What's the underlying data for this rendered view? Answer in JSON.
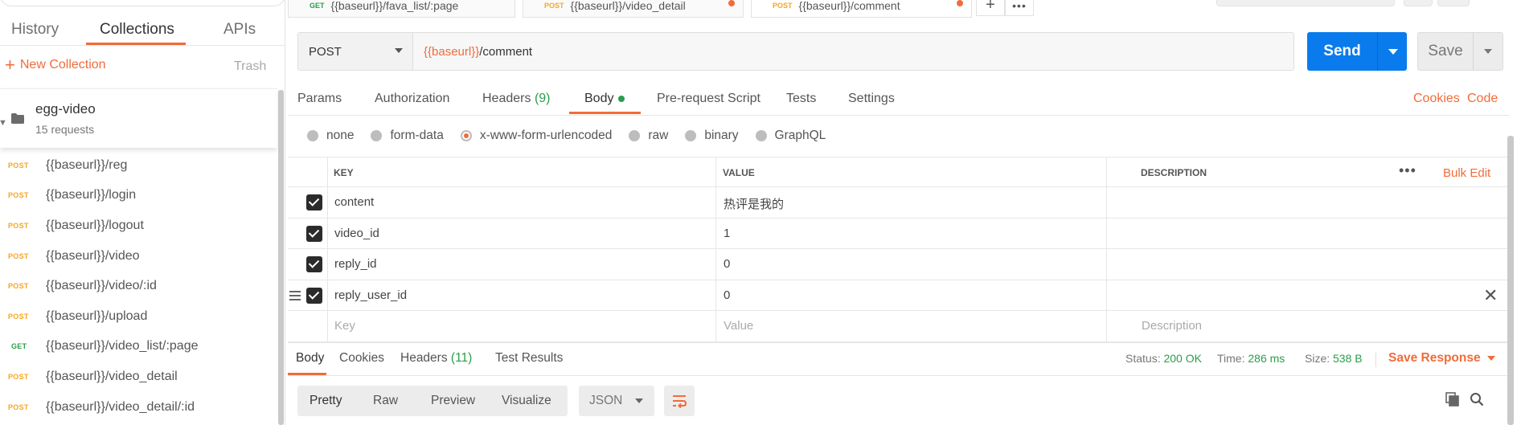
{
  "sidebar": {
    "tabs": [
      "History",
      "Collections",
      "APIs"
    ],
    "active_tab": "Collections",
    "new_collection": "New Collection",
    "trash": "Trash",
    "collection": {
      "name": "egg-video",
      "count": "15 requests"
    },
    "requests": [
      {
        "method": "POST",
        "path": "{{baseurl}}/reg"
      },
      {
        "method": "POST",
        "path": "{{baseurl}}/login"
      },
      {
        "method": "POST",
        "path": "{{baseurl}}/logout"
      },
      {
        "method": "POST",
        "path": "{{baseurl}}/video"
      },
      {
        "method": "POST",
        "path": "{{baseurl}}/video/:id"
      },
      {
        "method": "POST",
        "path": "{{baseurl}}/upload"
      },
      {
        "method": "GET",
        "path": "{{baseurl}}/video_list/:page"
      },
      {
        "method": "POST",
        "path": "{{baseurl}}/video_detail"
      },
      {
        "method": "POST",
        "path": "{{baseurl}}/video_detail/:id"
      }
    ]
  },
  "open_tabs": [
    {
      "method": "GET",
      "path": "{{baseurl}}/fava_list/:page"
    },
    {
      "method": "POST",
      "path": "{{baseurl}}/video_detail"
    },
    {
      "method": "POST",
      "path": "{{baseurl}}/comment"
    }
  ],
  "request": {
    "method": "POST",
    "url_var": "{{baseurl}}",
    "url_path": "/comment",
    "send": "Send",
    "save": "Save"
  },
  "request_tabs": {
    "params": "Params",
    "authorization": "Authorization",
    "headers": "Headers",
    "headers_count": "(9)",
    "body": "Body",
    "pre_request": "Pre-request Script",
    "tests": "Tests",
    "settings": "Settings",
    "cookies": "Cookies",
    "code": "Code"
  },
  "body_types": [
    {
      "label": "none",
      "selected": false
    },
    {
      "label": "form-data",
      "selected": false
    },
    {
      "label": "x-www-form-urlencoded",
      "selected": true
    },
    {
      "label": "raw",
      "selected": false
    },
    {
      "label": "binary",
      "selected": false
    },
    {
      "label": "GraphQL",
      "selected": false
    }
  ],
  "table": {
    "headers": {
      "key": "KEY",
      "value": "VALUE",
      "description": "DESCRIPTION"
    },
    "bulk_edit": "Bulk Edit",
    "more": "•••",
    "rows": [
      {
        "key": "content",
        "value": "热评是我的"
      },
      {
        "key": "video_id",
        "value": "1"
      },
      {
        "key": "reply_id",
        "value": "0"
      },
      {
        "key": "reply_user_id",
        "value": "0"
      }
    ],
    "placeholders": {
      "key": "Key",
      "value": "Value",
      "description": "Description"
    }
  },
  "response": {
    "tabs": {
      "body": "Body",
      "cookies": "Cookies",
      "headers": "Headers",
      "headers_count": "(11)",
      "tests": "Test Results"
    },
    "status_label": "Status:",
    "status_value": "200 OK",
    "time_label": "Time:",
    "time_value": "286 ms",
    "size_label": "Size:",
    "size_value": "538 B",
    "save_response": "Save Response",
    "views": [
      "Pretty",
      "Raw",
      "Preview",
      "Visualize"
    ],
    "active_view": "Pretty",
    "format": "JSON"
  },
  "colors": {
    "accent": "#f26b3a",
    "send": "#097bed",
    "success": "#2a9d4a",
    "post": "#f5a623"
  }
}
